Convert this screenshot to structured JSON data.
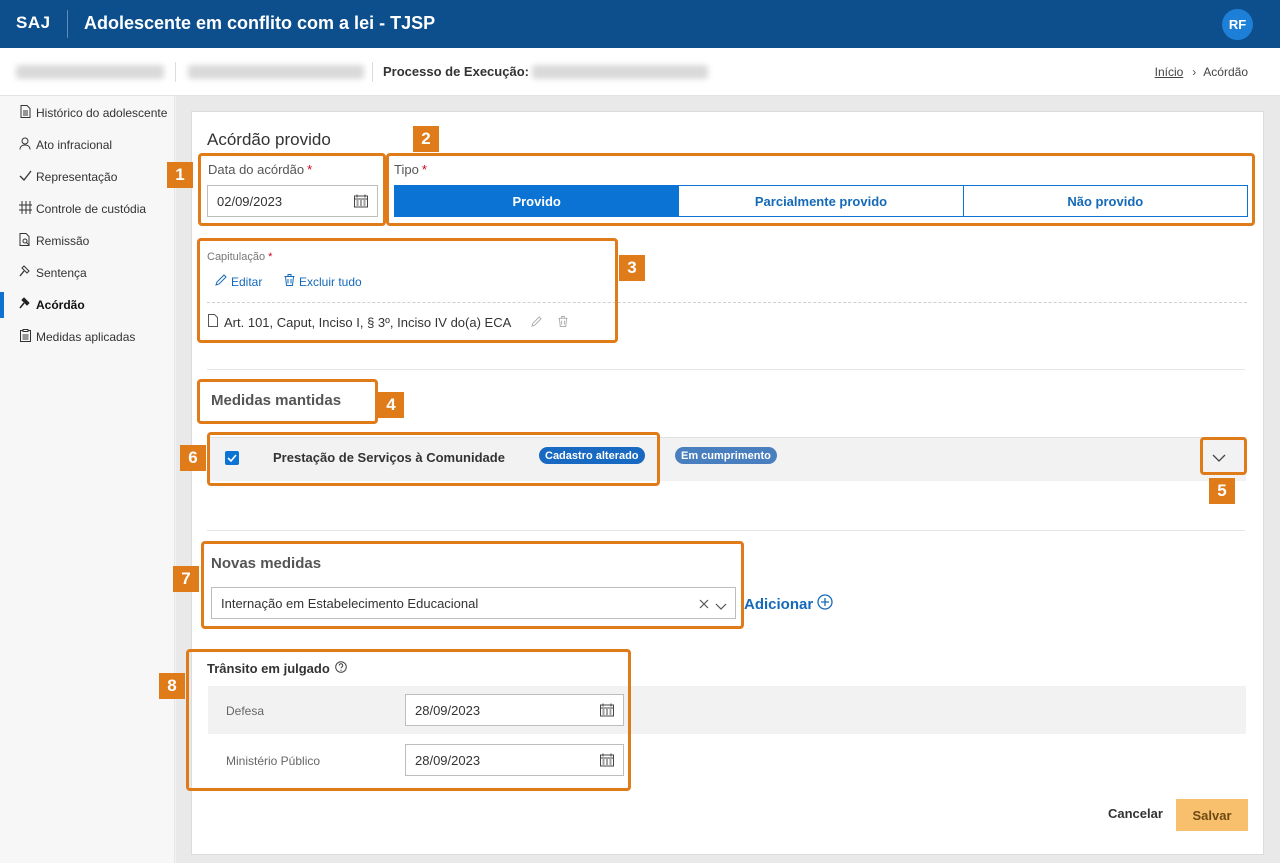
{
  "app": {
    "brand": "SAJ",
    "title": "Adolescente em conflito com a lei - TJSP",
    "avatar": "RF",
    "header_color": "#0c4f8c"
  },
  "subbar": {
    "process_label": "Processo de Execução:"
  },
  "breadcrumb": {
    "home": "Início",
    "current": "Acórdão"
  },
  "sidebar": {
    "items": [
      {
        "label": "Histórico do adolescente",
        "icon": "document-icon"
      },
      {
        "label": "Ato infracional",
        "icon": "person-icon"
      },
      {
        "label": "Representação",
        "icon": "check-icon"
      },
      {
        "label": "Controle de custódia",
        "icon": "grid-icon"
      },
      {
        "label": "Remissão",
        "icon": "document-search-icon"
      },
      {
        "label": "Sentença",
        "icon": "gavel-icon"
      },
      {
        "label": "Acórdão",
        "icon": "gavel-icon",
        "active": true
      },
      {
        "label": "Medidas aplicadas",
        "icon": "clipboard-icon"
      }
    ]
  },
  "form": {
    "title": "Acórdão provido",
    "data_acordao": {
      "label": "Data do acórdão",
      "required_mark": "*",
      "value": "02/09/2023"
    },
    "tipo": {
      "label": "Tipo",
      "required_mark": "*",
      "options": [
        "Provido",
        "Parcialmente provido",
        "Não provido"
      ],
      "selected": "Provido"
    },
    "capitulacao": {
      "label": "Capitulação",
      "required_mark": "*",
      "edit_label": "Editar",
      "delete_all_label": "Excluir tudo",
      "item": "Art. 101, Caput, Inciso I, § 3º, Inciso IV do(a) ECA"
    },
    "medidas_mantidas": {
      "title": "Medidas mantidas",
      "row": {
        "name": "Prestação de Serviços à Comunidade",
        "badge_1": "Cadastro alterado",
        "badge_2": "Em cumprimento",
        "checked": true
      }
    },
    "novas_medidas": {
      "title": "Novas medidas",
      "value": "Internação em Estabelecimento Educacional",
      "add_label": "Adicionar"
    },
    "transito": {
      "title": "Trânsito em julgado",
      "defesa_label": "Defesa",
      "defesa_value": "28/09/2023",
      "mp_label": "Ministério Público",
      "mp_value": "28/09/2023"
    },
    "buttons": {
      "cancel": "Cancelar",
      "save": "Salvar"
    }
  },
  "annotations": [
    "1",
    "2",
    "3",
    "4",
    "5",
    "6",
    "7",
    "8"
  ],
  "colors": {
    "accent": "#0a73d3",
    "annotation": "#e07b1a",
    "save_button": "#f8c06d",
    "badge_blue": "#1769c2",
    "badge_steel": "#4a7fbf"
  }
}
